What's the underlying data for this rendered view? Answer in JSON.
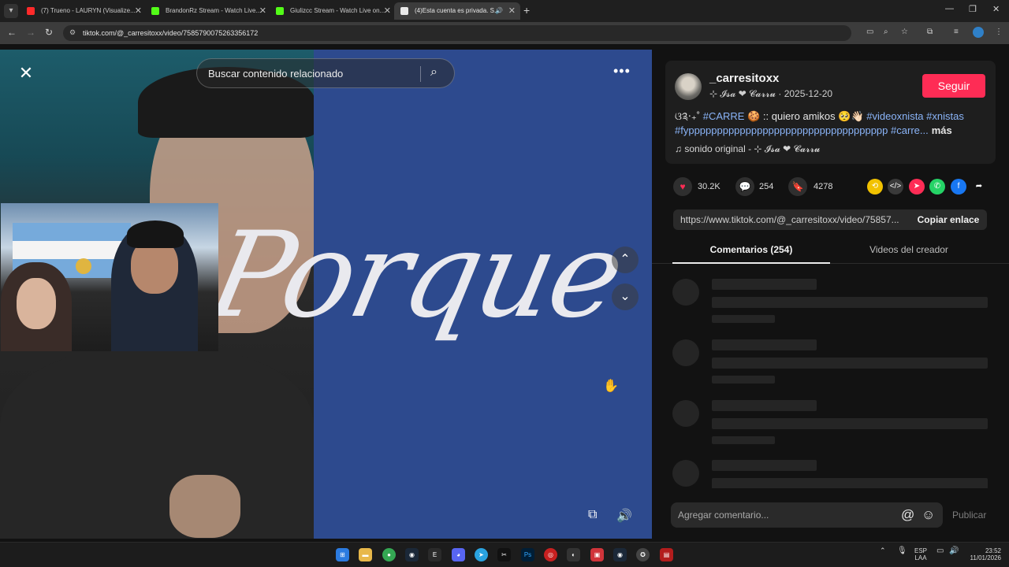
{
  "browser": {
    "tabs": [
      {
        "title": "(7) Trueno - LAURYN (Visualize...",
        "favicon_color": "#ff2a2a"
      },
      {
        "title": "BrandonRz Stream - Watch Live...",
        "favicon_color": "#53fc18"
      },
      {
        "title": "Giulizcc Stream - Watch Live on...",
        "favicon_color": "#53fc18"
      },
      {
        "title": "(4)Esta cuenta es privada. S...",
        "favicon_color": "#e8e8e8"
      }
    ],
    "url": "tiktok.com/@_carresitoxx/video/7585790075263356172"
  },
  "video": {
    "search_placeholder": "Buscar contenido relacionado",
    "overlay_text": "Porque"
  },
  "post": {
    "username": "_carresitoxx",
    "nickname": "⊹ 𝓘𝓼𝓪 ❤ 𝓒𝓪𝓻𝓻𝓾",
    "date": "· 2025-12-20",
    "follow_label": "Seguir",
    "desc_prefix": "ଓ༉‧₊˚ ",
    "desc_tag1": "#CARRE",
    "desc_mid": " 🍪 :: quiero amikos 🥺👋🏻 ",
    "desc_tag2": "#videoxnista",
    "desc_tag3": "#xnistas",
    "desc_tag4": "#fyppppppppppppppppppppppppppppppppppp",
    "desc_tag5": "#carre...",
    "more_label": "más",
    "music": "sonido original - ⊹ 𝓘𝓼𝓪 ❤ 𝓒𝓪𝓻𝓻𝓾",
    "likes": "30.2K",
    "comments": "254",
    "saves": "4278",
    "share_link": "https://www.tiktok.com/@_carresitoxx/video/75857...",
    "copy_label": "Copiar enlace",
    "tab_comments": "Comentarios (254)",
    "tab_videos": "Videos del creador",
    "comment_placeholder": "Agregar comentario...",
    "publish_label": "Publicar"
  },
  "taskbar": {
    "lang": "ESP",
    "lang2": "LAA",
    "time": "23:52",
    "date": "11/01/2026"
  },
  "colors": {
    "accent": "#fe2c55",
    "hashtag": "#8ab4f8",
    "panel_bg": "#121212",
    "video_blue": "#2d4a8e"
  }
}
